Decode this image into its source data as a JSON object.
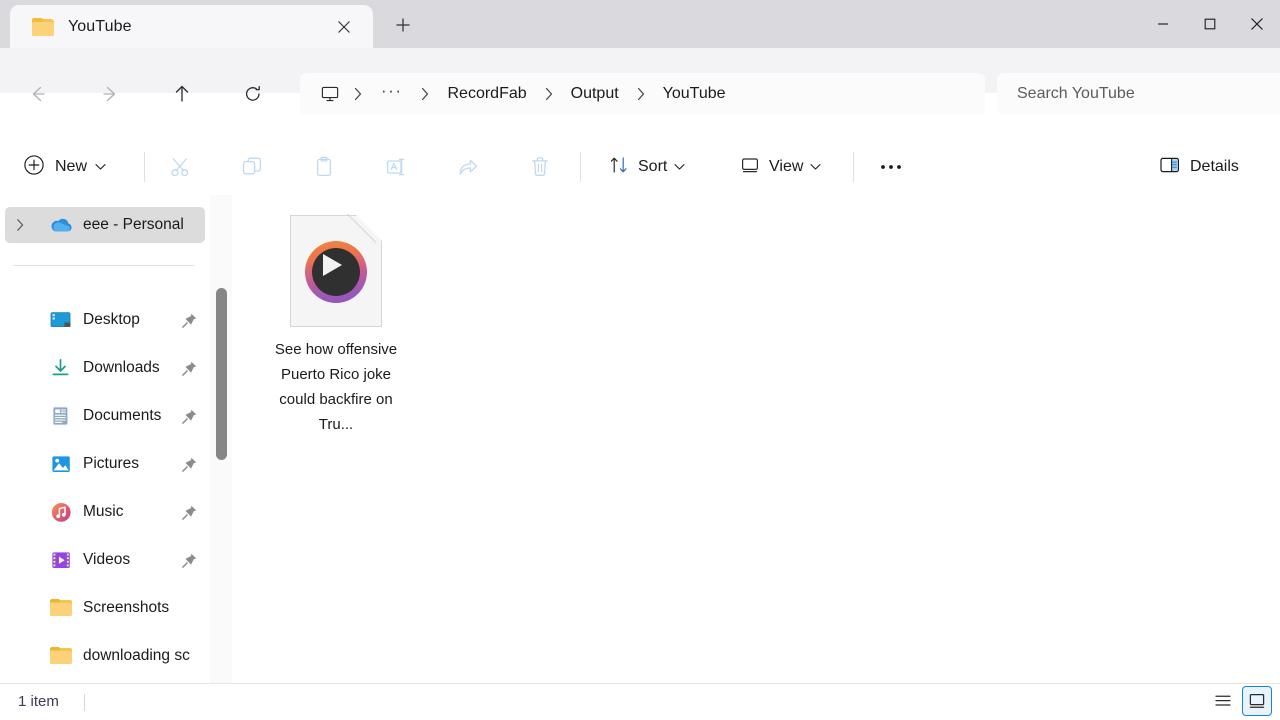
{
  "window": {
    "tab": {
      "title": "YouTube",
      "icon": "folder-icon",
      "close_icon": "close-icon"
    },
    "new_tab_label": "+",
    "controls": {
      "minimize": "minimize-icon",
      "maximize": "maximize-icon",
      "close": "close-icon"
    }
  },
  "nav": {
    "back": "back-arrow-icon",
    "forward": "forward-arrow-icon",
    "up": "up-arrow-icon",
    "refresh": "refresh-icon"
  },
  "address": {
    "root_icon": "this-pc-monitor-icon",
    "overflow": "···",
    "crumbs": [
      "RecordFab",
      "Output",
      "YouTube"
    ],
    "separator": "›"
  },
  "search": {
    "placeholder": "Search YouTube",
    "value": ""
  },
  "toolbar": {
    "new_label": "New",
    "new_icon": "plus-circle-icon",
    "chevron": "⌄",
    "cut_label": "Cut",
    "copy_label": "Copy",
    "paste_label": "Paste",
    "rename_label": "Rename",
    "share_label": "Share",
    "delete_label": "Delete",
    "sort_label": "Sort",
    "view_label": "View",
    "more_label": "•••",
    "details_label": "Details",
    "accent_color": "#1683d8",
    "disabled_color": "#bed9ef"
  },
  "sidebar": {
    "onedrive": {
      "label": "eee - Personal",
      "icon": "onedrive-cloud-icon",
      "expanded": false,
      "selected": true
    },
    "items": [
      {
        "label": "Desktop",
        "icon": "desktop-icon",
        "pinned": true
      },
      {
        "label": "Downloads",
        "icon": "downloads-icon",
        "pinned": true
      },
      {
        "label": "Documents",
        "icon": "documents-icon",
        "pinned": true
      },
      {
        "label": "Pictures",
        "icon": "pictures-icon",
        "pinned": true
      },
      {
        "label": "Music",
        "icon": "music-icon",
        "pinned": true
      },
      {
        "label": "Videos",
        "icon": "videos-icon",
        "pinned": true
      },
      {
        "label": "Screenshots",
        "icon": "folder-icon",
        "pinned": false
      },
      {
        "label": "downloading sc",
        "icon": "folder-icon",
        "pinned": false
      }
    ]
  },
  "content": {
    "files": [
      {
        "name": "See how offensive Puerto Rico joke could backfire on Tru...",
        "icon": "media-player-file-icon"
      }
    ]
  },
  "status": {
    "item_count": "1 item",
    "view_list_icon": "details-view-icon",
    "view_tiles_icon": "large-icons-view-icon",
    "active_view": "large-icons-view-icon"
  }
}
